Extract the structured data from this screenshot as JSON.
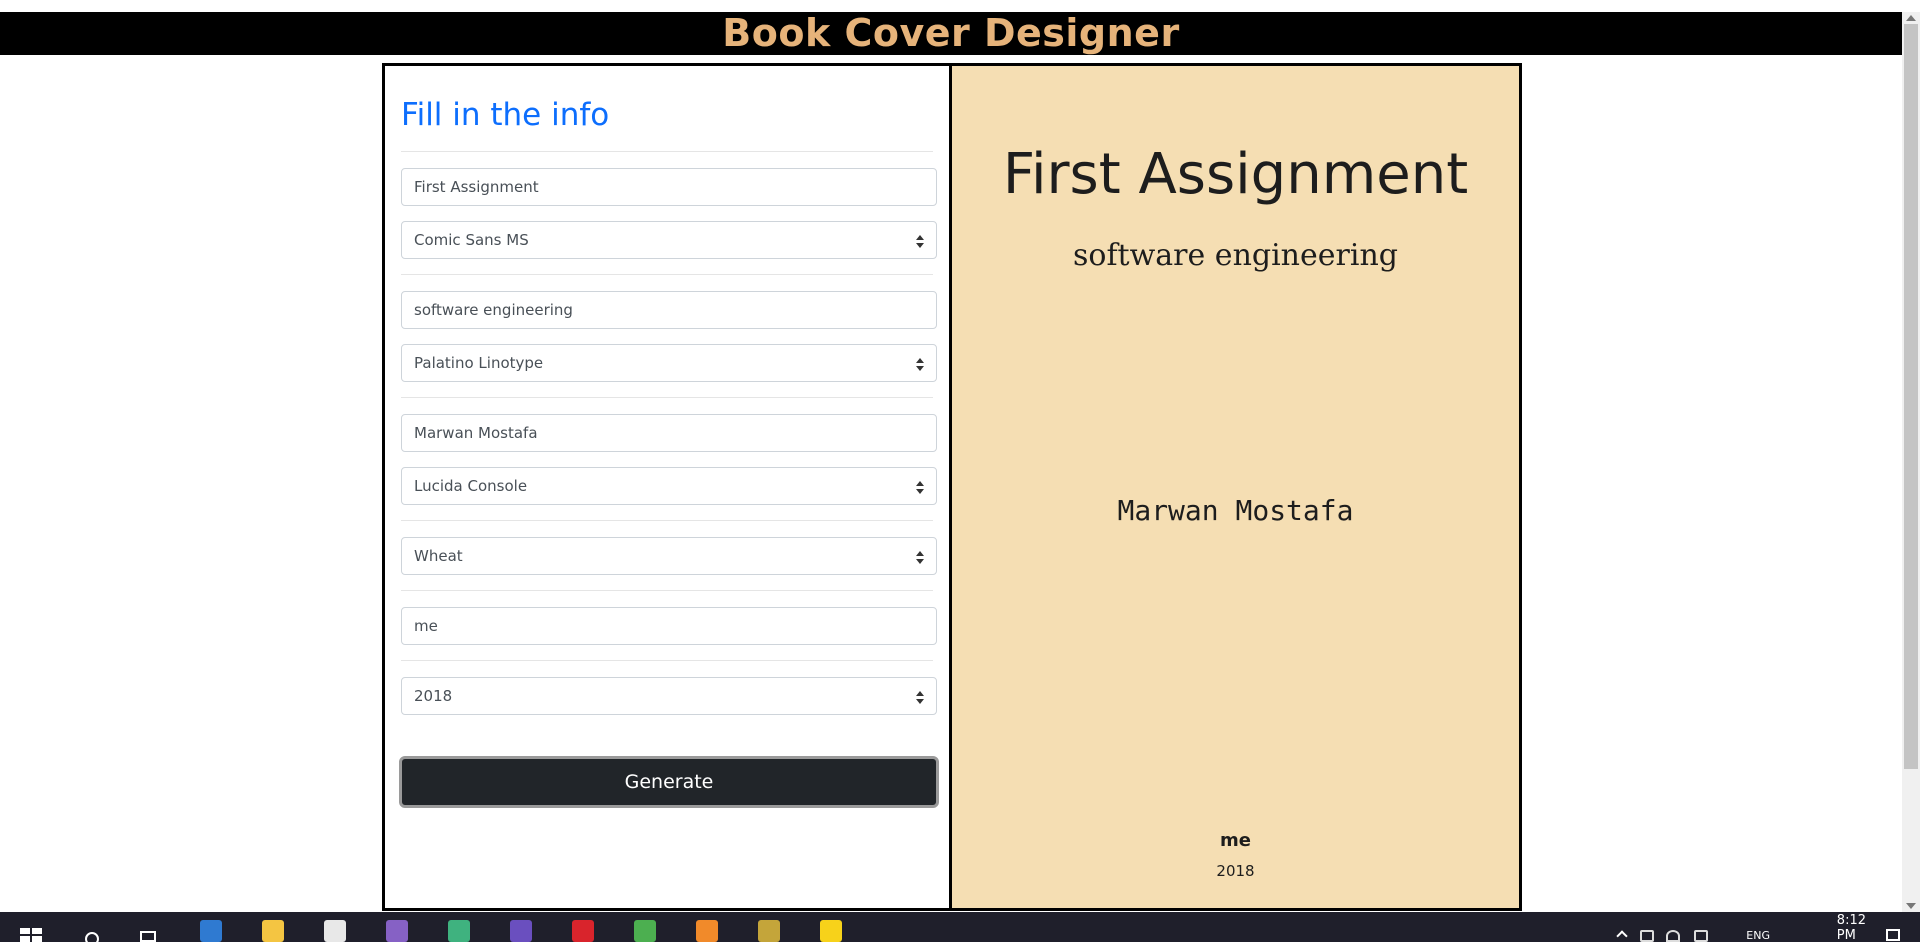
{
  "header": {
    "title": "Book Cover Designer"
  },
  "form": {
    "heading": "Fill in the info",
    "title_value": "First Assignment",
    "title_font": "Comic Sans MS",
    "subtitle_value": "software engineering",
    "subtitle_font": "Palatino Linotype",
    "author_value": "Marwan Mostafa",
    "author_font": "Lucida Console",
    "color": "Wheat",
    "publisher_value": "me",
    "year": "2018",
    "generate_label": "Generate"
  },
  "preview": {
    "title": "First Assignment",
    "subtitle": "software engineering",
    "author": "Marwan Mostafa",
    "publisher": "me",
    "year": "2018",
    "background_color": "#f5deb3"
  },
  "taskbar": {
    "time": "8:12 PM",
    "language": "ENG",
    "apps": [
      {
        "name": "edge-icon",
        "color": "#2f7ad1"
      },
      {
        "name": "file-explorer-icon",
        "color": "#f4c542"
      },
      {
        "name": "store-icon",
        "color": "#e8e8e8"
      },
      {
        "name": "visual-studio-icon",
        "color": "#8661c5"
      },
      {
        "name": "maps-icon",
        "color": "#3fb27f"
      },
      {
        "name": "visual-studio-2-icon",
        "color": "#6a4fbf"
      },
      {
        "name": "opera-icon",
        "color": "#d9242c"
      },
      {
        "name": "chrome-icon",
        "color": "#4caf50"
      },
      {
        "name": "firefox-icon",
        "color": "#f18a2a"
      },
      {
        "name": "notepad-icon",
        "color": "#c4a53a"
      },
      {
        "name": "sticky-notes-icon",
        "color": "#f7d21a"
      }
    ]
  }
}
